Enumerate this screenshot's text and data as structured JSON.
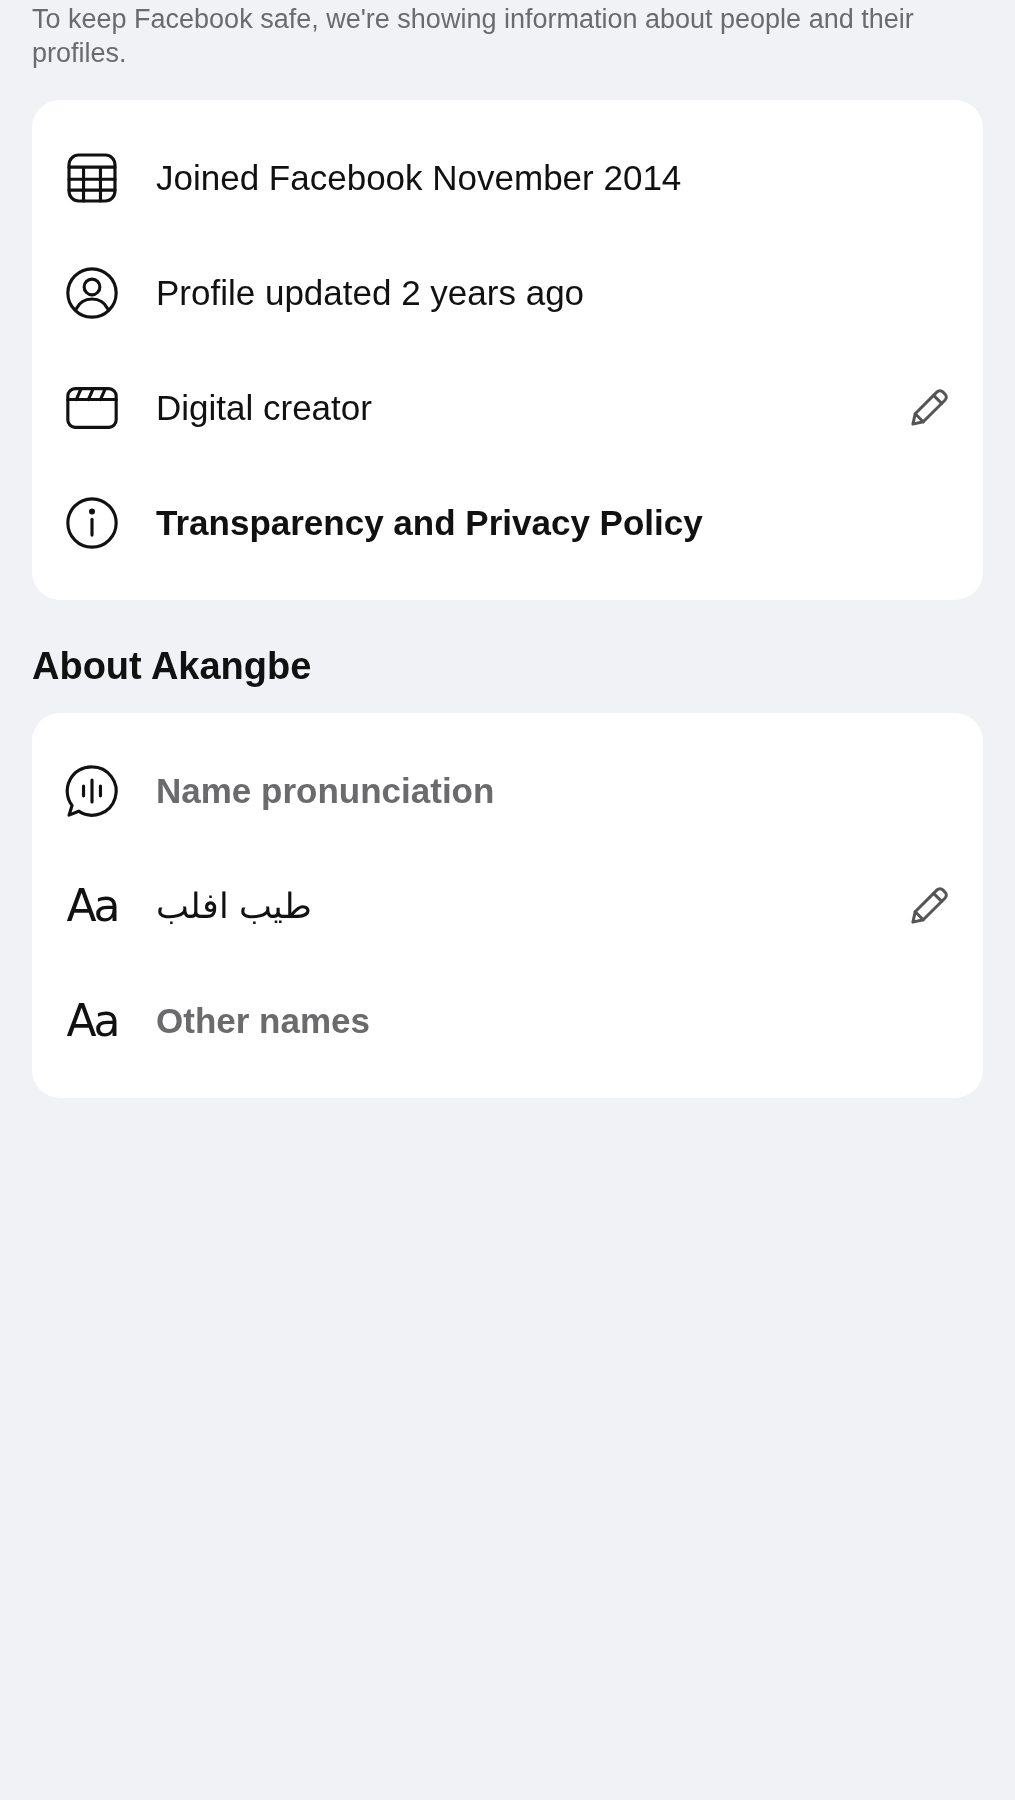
{
  "intro": "To keep Facebook safe, we're showing information about people and their profiles.",
  "profile_card": {
    "rows": [
      {
        "kind": "text",
        "label": "Joined Facebook November 2014",
        "editable": false
      },
      {
        "kind": "text",
        "label": "Profile updated 2 years ago",
        "editable": false
      },
      {
        "kind": "text",
        "label": "Digital creator",
        "editable": true
      },
      {
        "kind": "link",
        "label": "Transparency and Privacy Policy",
        "editable": false
      }
    ]
  },
  "about": {
    "heading": "About Akangbe",
    "rows": [
      {
        "kind": "placeholder",
        "label": "Name pronunciation",
        "editable": false
      },
      {
        "kind": "text",
        "glyph": "Aa",
        "label": "طيب افلب",
        "editable": true
      },
      {
        "kind": "placeholder",
        "glyph": "Aa",
        "label": "Other names",
        "editable": false
      }
    ]
  }
}
